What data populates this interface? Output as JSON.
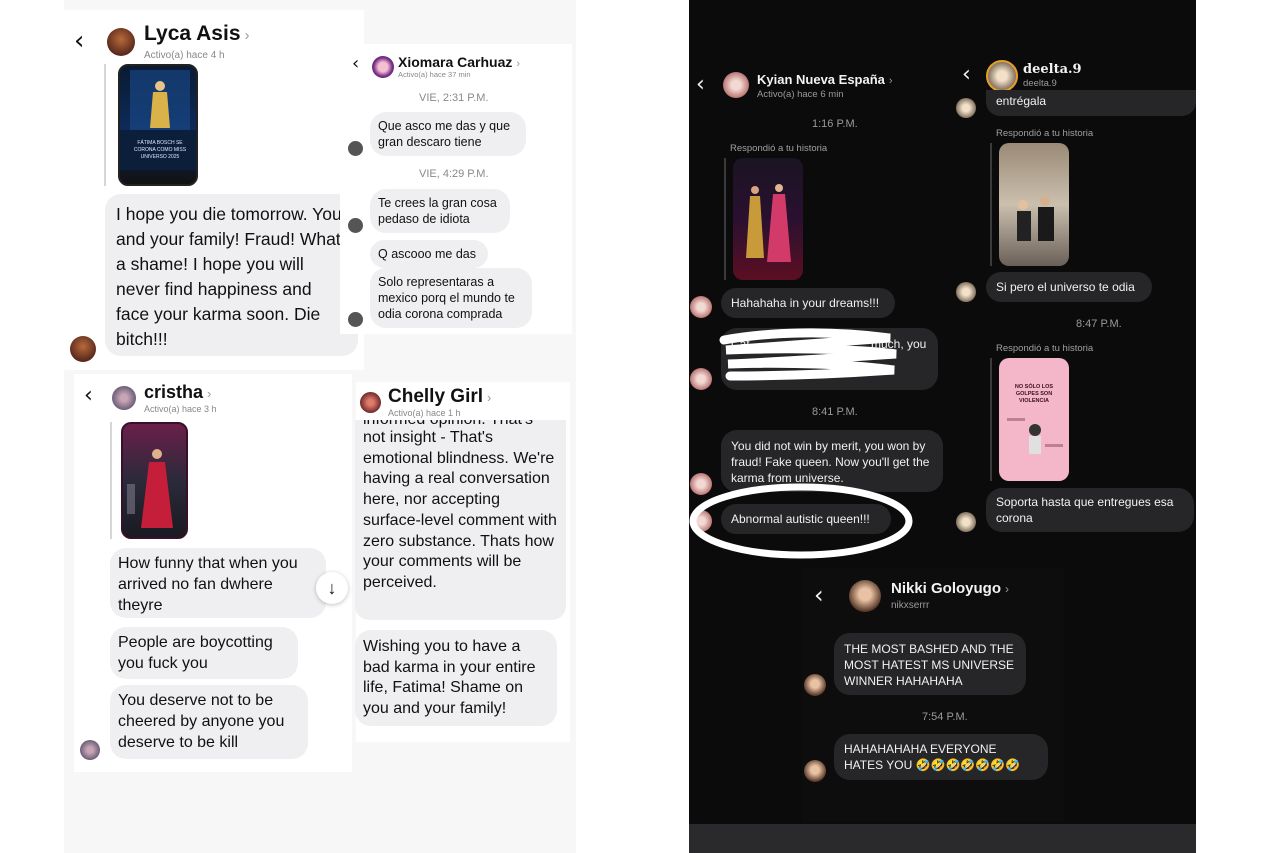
{
  "lyca": {
    "name": "Lyca Asis",
    "status": "Activo(a) hace 4 h",
    "message": "I hope you die tomorrow. You and your family! Fraud! What a shame! I hope you will never find happiness and face your karma soon. Die bitch!!!",
    "story_caption": "FÁTIMA BOSCH SE CORONA COMO MISS UNIVERSO 2025"
  },
  "xiomara": {
    "name": "Xiomara Carhuaz",
    "status": "Activo(a) hace 37 min",
    "time1": "VIE, 2:31 P.M.",
    "msg1": "Que asco me das y que gran descaro tiene",
    "time2": "VIE, 4:29 P.M.",
    "msg2": "Te crees la gran cosa pedaso de idiota",
    "msg3": "Q ascooo me das",
    "msg4": "Solo representaras a mexico porq el mundo te odia corona comprada"
  },
  "cristha": {
    "name": "cristha",
    "status": "Activo(a) hace 3 h",
    "msg1": "How funny that when you arrived no fan dwhere theyre",
    "msg2": "People are boycotting you fuck you",
    "msg3": "You deserve not to be cheered by anyone you deserve to be kill"
  },
  "chelly": {
    "name": "Chelly Girl",
    "status": "Activo(a) hace 1 h",
    "msg1_cut": "informed opinion. That's",
    "msg1": "not insight - That's emotional blindness. We're having a real conversation here, nor accepting surface-level comment with zero substance. Thats how your comments will be perceived.",
    "msg2": "Wishing you to have a bad karma in your entire life, Fatima! Shame on you and your family!"
  },
  "kyian": {
    "name": "Kyian Nueva España",
    "status": "Activo(a) hace 6 min",
    "time1": "1:16 P.M.",
    "replied": "Respondió a tu historia",
    "msg1": "Hahahaha in your dreams!!!",
    "msg2_visible_start": "Cat",
    "msg2_visible_end": "much, you",
    "msg2_visible_line2": "differ",
    "time2": "8:41 P.M.",
    "msg3": "You did not win by merit, you won by fraud! Fake queen. Now you'll get the karma from universe.",
    "msg4": "Abnormal autistic queen!!!"
  },
  "deelta": {
    "name": "deelta.9",
    "handle": "deelta.9",
    "msg0": "entrégala",
    "replied1": "Respondió a tu historia",
    "msg1": "Si pero el universo te odia",
    "time": "8:47 P.M.",
    "replied2": "Respondió a tu historia",
    "story_text": "NO SÓLO LOS GOLPES SON VIOLENCIA",
    "msg2": "Soporta hasta que entregues esa corona"
  },
  "nikki": {
    "name": "Nikki Goloyugo",
    "handle": "nikxserrr",
    "msg1": "THE MOST BASHED AND THE MOST HATEST MS UNIVERSE WINNER HAHAHAHA",
    "time": "7:54 P.M.",
    "msg2": "HAHAHAHAHA EVERYONE HATES YOU 🤣🤣🤣🤣🤣🤣🤣"
  },
  "icons": {
    "back": "chevron-left-icon",
    "chevron": "chevron-right-icon",
    "scroll_down": "arrow-down-icon"
  },
  "colors": {
    "light_bg": "#f7f7f8",
    "dark_bg": "#0b0b0c",
    "bubble_light": "#efeff1",
    "bubble_dark": "#262628"
  }
}
